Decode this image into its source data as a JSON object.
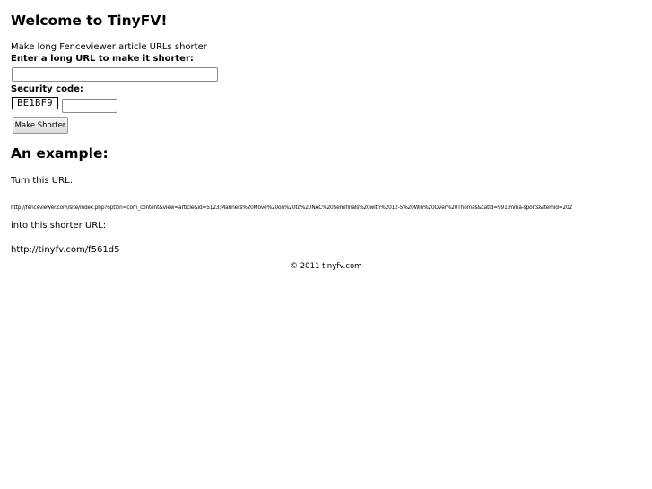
{
  "header": {
    "title": "Welcome to TinyFV!",
    "tagline": "Make long Fenceviewer article URLs shorter"
  },
  "form": {
    "url_label": "Enter a long URL to make it shorter:",
    "url_value": "",
    "security_label": "Security code:",
    "captcha_code": "BE1BF9",
    "code_value": "",
    "submit_label": "Make Shorter"
  },
  "example": {
    "heading": "An example:",
    "turn_text": "Turn this URL:",
    "long_url": "http://fenceviewer.com/site/index.php?option=com_content&view=article&id=5123:Mariners%20Move%20on%20to%20NAC%20Semifinals%20with%2012-5%20Win%20Over%20Thomas&catid=991:mma-sports&Itemid=202",
    "into_text": "into this shorter URL:",
    "short_url": "http://tinyfv.com/f561d5"
  },
  "footer": {
    "copyright": "© 2011 tinyfv.com"
  }
}
